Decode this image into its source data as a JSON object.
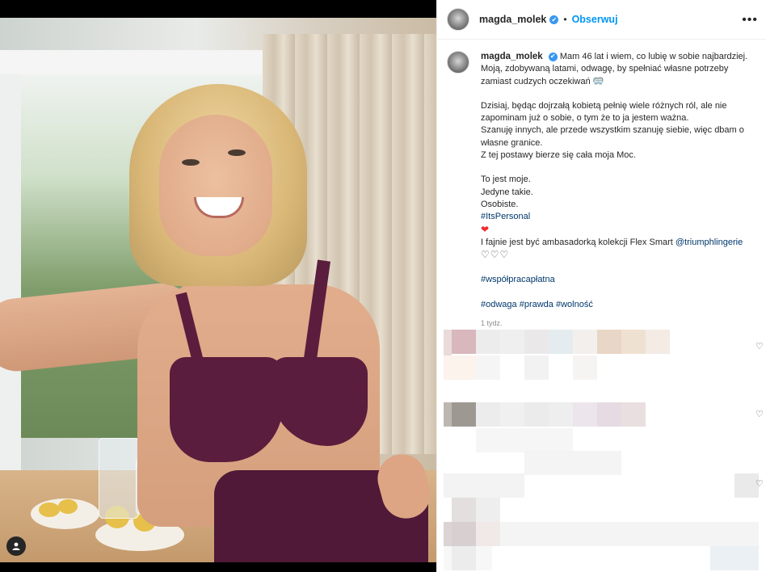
{
  "post": {
    "username": "magda_molek",
    "verified_glyph": "✔",
    "separator": "•",
    "follow_label": "Obserwuj",
    "more_icon": "more-options-icon"
  },
  "caption": {
    "username": "magda_molek",
    "line1": "Mam 46 lat i wiem, co lubię w sobie najbardziej. Moją, zdobywaną latami, odwagę, by spełniać własne potrzeby zamiast cudzych oczekiwań 🥽",
    "para2_line1": "Dzisiaj, będąc dojrzałą kobietą pełnię wiele różnych ról, ale nie zapominam już o sobie, o tym że to ja jestem ważna.",
    "para2_line2": "Szanuję innych, ale przede wszystkim szanuję siebie, więc dbam o własne granice.",
    "para2_line3": "Z tej postawy bierze się cała moja Moc.",
    "para3_line1": "To jest moje.",
    "para3_line2": "Jedyne takie.",
    "para3_line3": "Osobiste.",
    "hashtag_personal": "#ItsPersonal",
    "heart_red": "❤",
    "ambassador_text": "I fajnie jest być ambasadorką kolekcji Flex Smart ",
    "ambassador_mention": "@triumphlingerie",
    "hearts_outline": "♡♡♡",
    "hashtag_collab": "#współpracapłatna",
    "hashtag_odwaga": "#odwaga",
    "hashtag_prawda": "#prawda",
    "hashtag_wolnosc": "#wolność",
    "timestamp": "1 tydz."
  },
  "icons": {
    "user_tag": "user-tag-icon"
  },
  "colors": {
    "link_blue": "#0095f6",
    "hashtag": "#00376b",
    "verified": "#3897f0",
    "bra": "#5a1d3d"
  }
}
